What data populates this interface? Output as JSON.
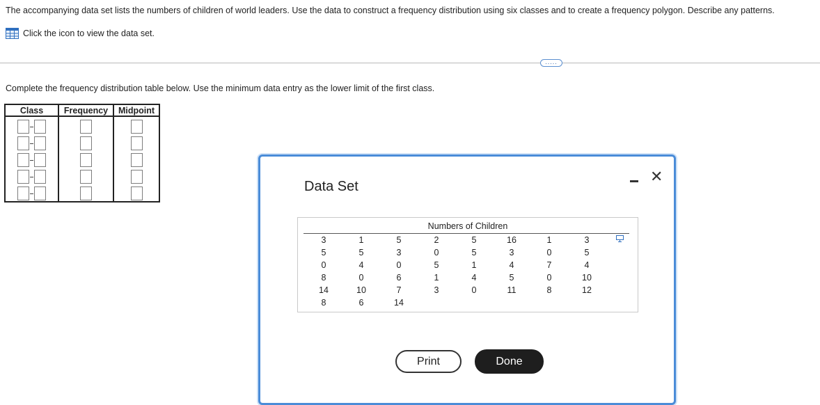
{
  "question": {
    "text": "The accompanying data set lists the numbers of children of world leaders. Use the data to construct a frequency distribution using six classes and to create a frequency polygon. Describe any patterns.",
    "data_link": "Click the icon to view the data set.",
    "data_icon": "spreadsheet-icon",
    "more_button": "....."
  },
  "instruction": "Complete the frequency distribution table below. Use the minimum data entry as the lower limit of the first class.",
  "freq_table": {
    "headers": [
      "Class",
      "Frequency",
      "Midpoint"
    ],
    "rows": [
      {
        "class_lower": "",
        "class_upper": "",
        "frequency": "",
        "midpoint": ""
      },
      {
        "class_lower": "",
        "class_upper": "",
        "frequency": "",
        "midpoint": ""
      },
      {
        "class_lower": "",
        "class_upper": "",
        "frequency": "",
        "midpoint": ""
      },
      {
        "class_lower": "",
        "class_upper": "",
        "frequency": "",
        "midpoint": ""
      },
      {
        "class_lower": "",
        "class_upper": "",
        "frequency": "",
        "midpoint": ""
      },
      {
        "class_lower": "",
        "class_upper": "",
        "frequency": "",
        "midpoint": ""
      }
    ]
  },
  "modal": {
    "title": "Data Set",
    "minimize_label": "-",
    "close_label": "✕",
    "dataset": {
      "header": "Numbers of Children",
      "copy_icon": "copy-icon",
      "columns": [
        [
          "3",
          "5",
          "0",
          "8",
          "14",
          "8"
        ],
        [
          "1",
          "5",
          "4",
          "0",
          "10",
          "6"
        ],
        [
          "5",
          "3",
          "0",
          "6",
          "7",
          "14"
        ],
        [
          "2",
          "0",
          "5",
          "1",
          "3"
        ],
        [
          "5",
          "5",
          "1",
          "4",
          "0"
        ],
        [
          "16",
          "3",
          "4",
          "5",
          "11"
        ],
        [
          "1",
          "0",
          "7",
          "0",
          "8"
        ],
        [
          "3",
          "5",
          "4",
          "10",
          "12"
        ]
      ]
    },
    "print_label": "Print",
    "done_label": "Done"
  },
  "colors": {
    "accent": "#4a8cd8",
    "done_button": "#1e1e1e",
    "divider": "#b9b9b9"
  }
}
